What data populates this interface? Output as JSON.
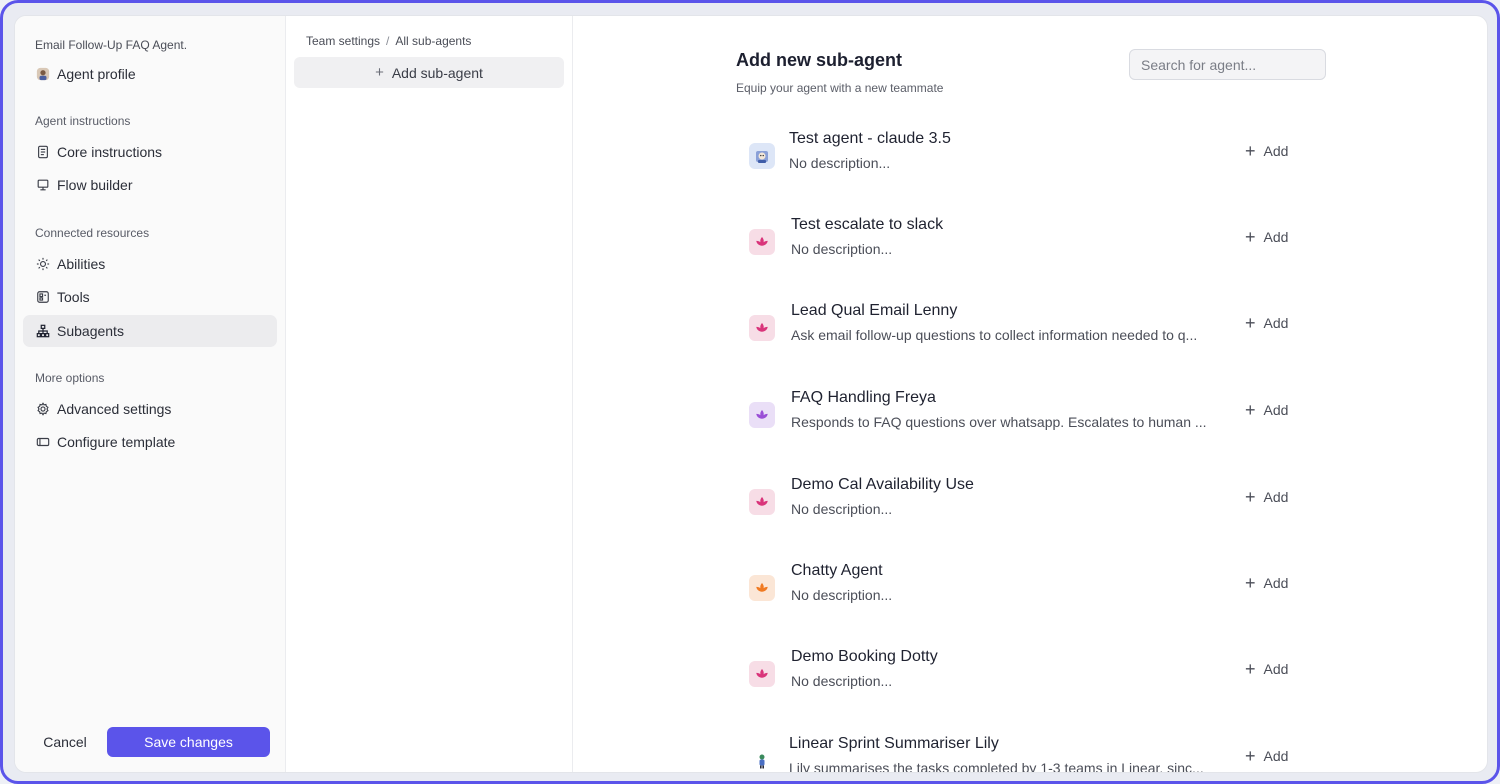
{
  "nav": {
    "agent_name": "Email Follow-Up FAQ Agent.",
    "profile_label": "Agent profile",
    "sections": {
      "instructions": "Agent instructions",
      "resources": "Connected resources",
      "more": "More options"
    },
    "items": {
      "core": "Core instructions",
      "flow": "Flow builder",
      "abilities": "Abilities",
      "tools": "Tools",
      "subagents": "Subagents",
      "advanced": "Advanced settings",
      "template": "Configure template"
    },
    "cancel": "Cancel",
    "save": "Save changes"
  },
  "middle": {
    "breadcrumb": [
      "Team settings",
      "/",
      "All sub-agents"
    ],
    "add_button": "Add sub-agent"
  },
  "main": {
    "title": "Add new sub-agent",
    "subtitle": "Equip your agent with a new teammate",
    "search_placeholder": "Search for agent...",
    "add_label": "Add",
    "agents": [
      {
        "name": "Test agent - claude 3.5",
        "description": "No description...",
        "icon": "robot-avatar-icon",
        "color": "#dde6f7"
      },
      {
        "name": "Test escalate to slack",
        "description": "No description...",
        "icon": "lotus-icon",
        "color": "#f7dde6"
      },
      {
        "name": "Lead Qual Email Lenny",
        "description": "Ask email follow-up questions to collect information needed to q...",
        "icon": "lotus-icon",
        "color": "#f7dde6"
      },
      {
        "name": "FAQ Handling Freya",
        "description": "Responds to FAQ questions over whatsapp. Escalates to human ...",
        "icon": "lotus-icon",
        "color": "#eadff7"
      },
      {
        "name": "Demo Cal Availability Use",
        "description": "No description...",
        "icon": "lotus-icon",
        "color": "#f7dde6"
      },
      {
        "name": "Chatty Agent",
        "description": "No description...",
        "icon": "lotus-icon",
        "color": "#fbe6d6"
      },
      {
        "name": "Demo Booking Dotty",
        "description": "No description...",
        "icon": "lotus-icon",
        "color": "#f7dde6"
      },
      {
        "name": "Linear Sprint Summariser Lily",
        "description": "Lily summarises the tasks completed by 1-3 teams in Linear, sinc...",
        "icon": "person-avatar-icon",
        "color": "#ffffff"
      }
    ]
  },
  "colors": {
    "accent": "#5b54ea",
    "lotus_pink": "#d9347a",
    "lotus_purple": "#9a4fd6",
    "lotus_orange": "#f07a22"
  }
}
